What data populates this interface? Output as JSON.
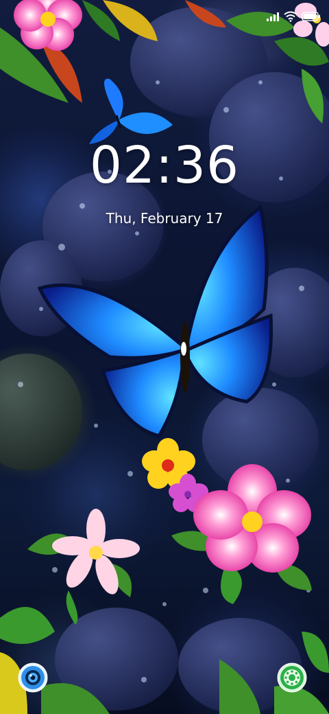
{
  "lock_screen": {
    "time": "02:36",
    "date": "Thu, February 17"
  },
  "status_bar": {
    "icons": [
      "signal-icon",
      "wifi-icon",
      "battery-icon"
    ],
    "battery_color": "#ffffff"
  },
  "shortcuts": {
    "left": {
      "icon": "camera-icon",
      "color": "#2f8fe8"
    },
    "right": {
      "icon": "phone-icon",
      "color": "#2bb04a"
    }
  },
  "wallpaper": {
    "accent_colors": [
      "#1e6bff",
      "#ff4fb4",
      "#ffd21f",
      "#3a9a2e"
    ]
  }
}
